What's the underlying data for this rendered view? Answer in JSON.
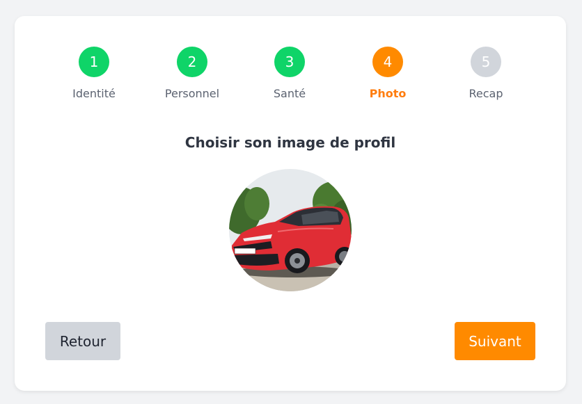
{
  "stepper": {
    "steps": [
      {
        "number": "1",
        "label": "Identité",
        "state": "done",
        "color": "#0fd468"
      },
      {
        "number": "2",
        "label": "Personnel",
        "state": "done",
        "color": "#0fd468"
      },
      {
        "number": "3",
        "label": "Santé",
        "state": "done",
        "color": "#0fd468"
      },
      {
        "number": "4",
        "label": "Photo",
        "state": "active",
        "color": "#ff8a00"
      },
      {
        "number": "5",
        "label": "Recap",
        "state": "pending",
        "color": "#d1d5db"
      }
    ]
  },
  "main": {
    "title": "Choisir son image de profil",
    "avatar_image": "profile-photo-red-car"
  },
  "footer": {
    "back_label": "Retour",
    "next_label": "Suivant"
  },
  "colors": {
    "accent": "#ff8a00",
    "done": "#0fd468",
    "pending": "#d1d5db"
  }
}
